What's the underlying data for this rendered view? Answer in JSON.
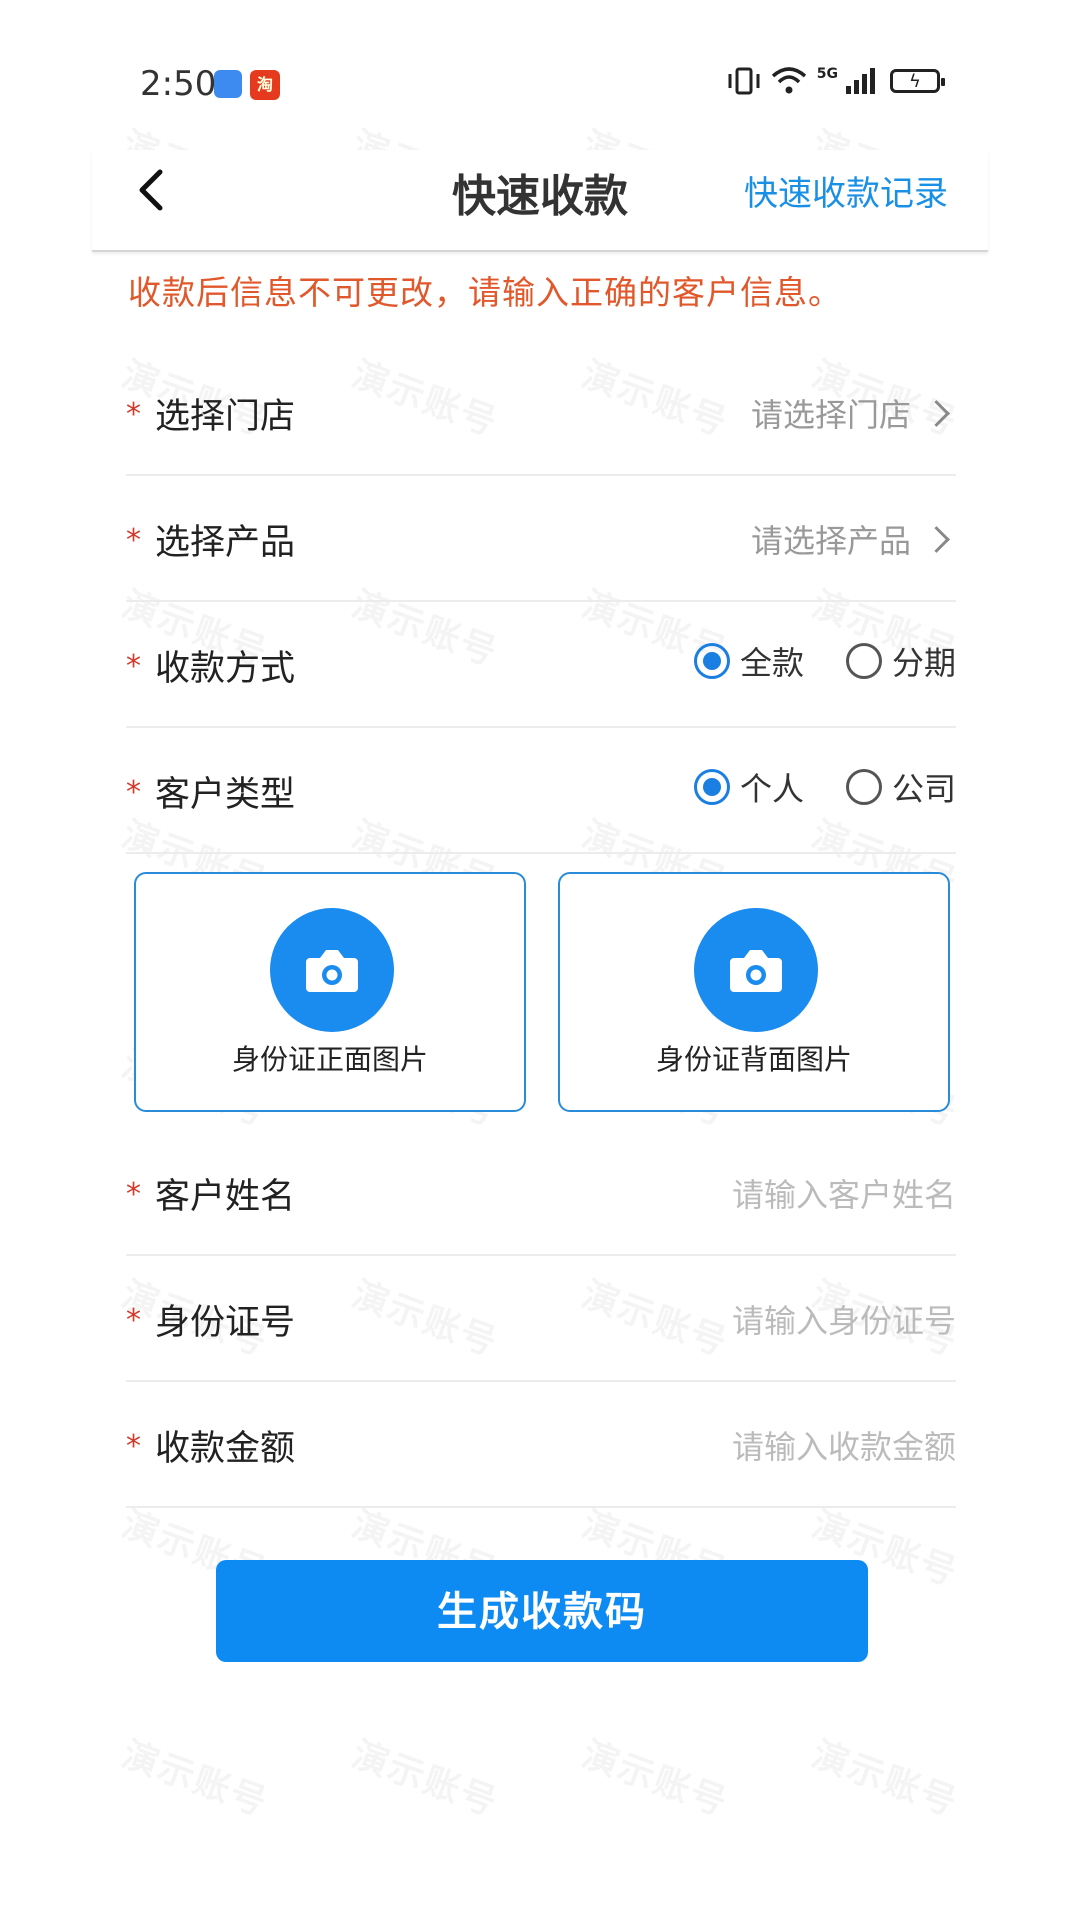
{
  "status_bar": {
    "time": "2:50",
    "network": "5G",
    "taobao_label": "淘"
  },
  "header": {
    "title": "快速收款",
    "records_link": "快速收款记录"
  },
  "notice": "收款后信息不可更改，请输入正确的客户信息。",
  "form": {
    "required_mark": "*",
    "store": {
      "label": "选择门店",
      "value": "请选择门店"
    },
    "product": {
      "label": "选择产品",
      "value": "请选择产品"
    },
    "payment_method": {
      "label": "收款方式",
      "options": [
        "全款",
        "分期"
      ],
      "selected": "全款"
    },
    "customer_type": {
      "label": "客户类型",
      "options": [
        "个人",
        "公司"
      ],
      "selected": "个人"
    },
    "id_front": "身份证正面图片",
    "id_back": "身份证背面图片",
    "customer_name": {
      "label": "客户姓名",
      "placeholder": "请输入客户姓名"
    },
    "id_number": {
      "label": "身份证号",
      "placeholder": "请输入身份证号"
    },
    "amount": {
      "label": "收款金额",
      "placeholder": "请输入收款金额"
    }
  },
  "submit_label": "生成收款码",
  "watermark_text": "演示账号",
  "colors": {
    "accent": "#0d8bf2",
    "notice": "#e0582b",
    "required": "#d23b2c"
  }
}
